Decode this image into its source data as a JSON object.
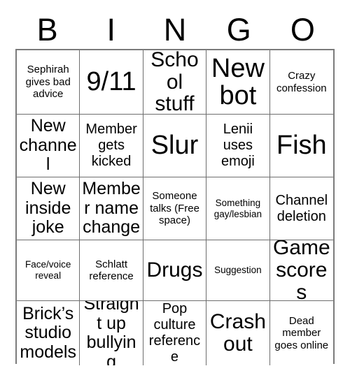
{
  "card": {
    "title_letters": [
      "B",
      "I",
      "N",
      "G",
      "O"
    ],
    "free_space_label": "Someone talks (Free space)",
    "border_color": "#7b7b7b",
    "text_color": "#000000",
    "background_color": "#ffffff",
    "columns": 5,
    "rows": 5,
    "cells": [
      {
        "text": "Sephirah gives bad advice",
        "size": "sm"
      },
      {
        "text": "9/11",
        "size": "xxl"
      },
      {
        "text": "School stuff",
        "size": "xl"
      },
      {
        "text": "New bot",
        "size": "xxl"
      },
      {
        "text": "Crazy confession",
        "size": "sm"
      },
      {
        "text": "New channel",
        "size": "lg"
      },
      {
        "text": "Member gets kicked",
        "size": "md"
      },
      {
        "text": "Slur",
        "size": "xxl"
      },
      {
        "text": "Lenii uses emoji",
        "size": "md"
      },
      {
        "text": "Fish",
        "size": "xxl"
      },
      {
        "text": "New inside joke",
        "size": "lg"
      },
      {
        "text": "Member name change",
        "size": "lg"
      },
      {
        "text": "Someone talks (Free space)",
        "size": "sm"
      },
      {
        "text": "Something gay/lesbian",
        "size": "xs"
      },
      {
        "text": "Channel deletion",
        "size": "md"
      },
      {
        "text": "Face/voice reveal",
        "size": "xs"
      },
      {
        "text": "Schlatt reference",
        "size": "sm"
      },
      {
        "text": "Drugs",
        "size": "xl"
      },
      {
        "text": "Suggestion",
        "size": "xs"
      },
      {
        "text": "Game scores",
        "size": "xl"
      },
      {
        "text": "Brick’s studio models",
        "size": "lg"
      },
      {
        "text": "Straight up bullying",
        "size": "lg"
      },
      {
        "text": "Pop culture reference",
        "size": "md"
      },
      {
        "text": "Crash out",
        "size": "xl"
      },
      {
        "text": "Dead member goes online",
        "size": "sm"
      }
    ]
  }
}
